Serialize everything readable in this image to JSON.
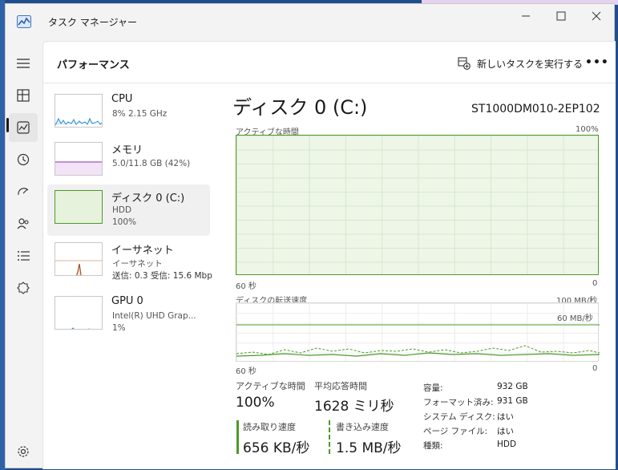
{
  "window": {
    "title": "タスク マネージャー"
  },
  "header": {
    "page_title": "パフォーマンス",
    "new_task_label": "新しいタスクを実行する",
    "more_label": "•••"
  },
  "nav": {
    "items": [
      "hamburger-icon",
      "processes-icon",
      "performance-icon",
      "app-history-icon",
      "startup-apps-icon",
      "users-icon",
      "details-icon",
      "services-icon",
      "settings-icon"
    ],
    "active": "performance"
  },
  "perf_list": [
    {
      "name": "CPU",
      "sub1": "8%  2.15 GHz",
      "sub2": ""
    },
    {
      "name": "メモリ",
      "sub1": "5.0/11.8 GB (42%)",
      "sub2": ""
    },
    {
      "name": "ディスク 0 (C:)",
      "sub1": "HDD",
      "sub2": "100%"
    },
    {
      "name": "イーサネット",
      "sub1": "イーサネット",
      "sub2": "送信: 0.3  受信: 15.6 Mbp"
    },
    {
      "name": "GPU 0",
      "sub1": "Intel(R) UHD Grap...",
      "sub2": "1%"
    }
  ],
  "detail": {
    "title": "ディスク 0 (C:)",
    "model": "ST1000DM010-2EP102",
    "graph1": {
      "label": "アクティブな時間",
      "max": "100%",
      "left": "60 秒",
      "right": "0"
    },
    "graph2": {
      "label": "ディスクの転送速度",
      "max": "100 MB/秒",
      "marker": "60 MB/秒",
      "left": "60 秒",
      "right": "0"
    },
    "stats": {
      "active_label": "アクティブな時間",
      "active_value": "100%",
      "resp_label": "平均応答時間",
      "resp_value": "1628 ミリ秒",
      "read_label": "読み取り速度",
      "read_value": "656 KB/秒",
      "write_label": "書き込み速度",
      "write_value": "1.5 MB/秒"
    },
    "props": [
      {
        "key": "容量:",
        "val": "932 GB"
      },
      {
        "key": "フォーマット済み:",
        "val": "931 GB"
      },
      {
        "key": "システム ディスク:",
        "val": "はい"
      },
      {
        "key": "ページ ファイル:",
        "val": "はい"
      },
      {
        "key": "種類:",
        "val": "HDD"
      }
    ]
  },
  "colors": {
    "accent": "#4c9a2a",
    "cpu": "#2a8dd4",
    "memory": "#8b2fa8",
    "ethernet": "#a0522d"
  }
}
